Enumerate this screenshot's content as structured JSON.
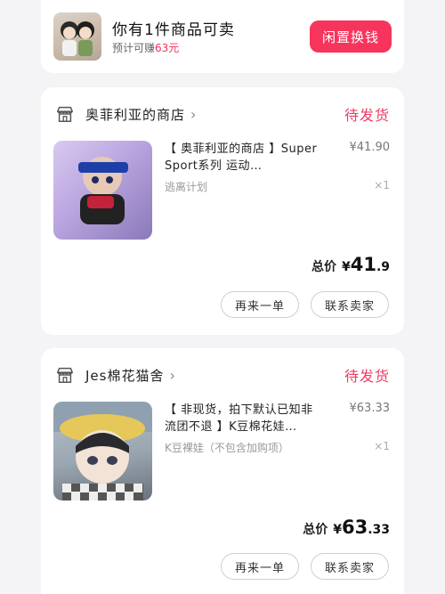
{
  "banner": {
    "title": "你有1件商品可卖",
    "subtitle_prefix": "预计可赚",
    "subtitle_amount": "63元",
    "action_label": "闲置换钱"
  },
  "orders": [
    {
      "shop_name": "奥菲利亚的商店",
      "status": "待发货",
      "product_title": "【 奥菲利亚的商店 】Super Sport系列 运动…",
      "spec": "逃离计划",
      "price": "¥41.90",
      "qty": "×1",
      "total_label": "总价",
      "total_currency": "¥",
      "total_int": "41",
      "total_dec": ".9",
      "rebuy_label": "再来一单",
      "contact_label": "联系卖家"
    },
    {
      "shop_name": "Jes棉花猫舍",
      "status": "待发货",
      "product_title": "【 非现货，拍下默认已知非流团不退 】K豆棉花娃…",
      "spec": "K豆裸娃（不包含加购项）",
      "price": "¥63.33",
      "qty": "×1",
      "total_label": "总价",
      "total_currency": "¥",
      "total_int": "63",
      "total_dec": ".33",
      "rebuy_label": "再来一单",
      "contact_label": "联系卖家"
    }
  ],
  "colors": {
    "accent": "#f7345c",
    "status": "#ee3a64",
    "background": "#f4f4f6"
  },
  "icons": {
    "shop": "store-icon",
    "chevron": "chevron-right-icon"
  }
}
